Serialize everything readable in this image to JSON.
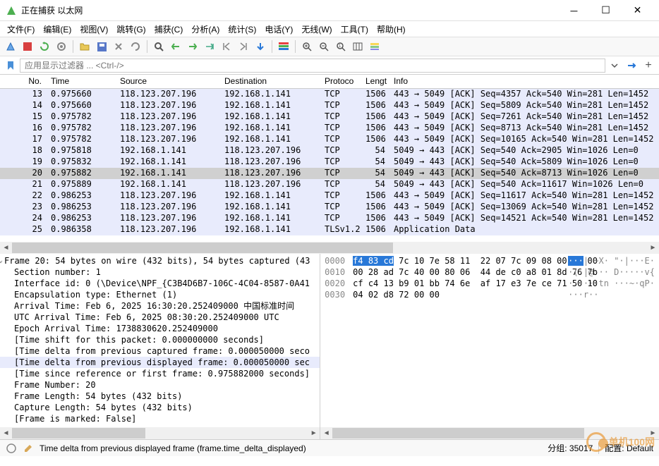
{
  "window": {
    "title": "正在捕获 以太网"
  },
  "menu": [
    {
      "label": "文件(F)"
    },
    {
      "label": "编辑(E)"
    },
    {
      "label": "视图(V)"
    },
    {
      "label": "跳转(G)"
    },
    {
      "label": "捕获(C)"
    },
    {
      "label": "分析(A)"
    },
    {
      "label": "统计(S)"
    },
    {
      "label": "电话(Y)"
    },
    {
      "label": "无线(W)"
    },
    {
      "label": "工具(T)"
    },
    {
      "label": "帮助(H)"
    }
  ],
  "filter": {
    "placeholder": "应用显示过滤器 ... <Ctrl-/>"
  },
  "columns": {
    "no": "No.",
    "time": "Time",
    "src": "Source",
    "dst": "Destination",
    "proto": "Protoco",
    "len": "Lengt",
    "info": "Info"
  },
  "packets": [
    {
      "no": 13,
      "time": "0.975660",
      "src": "118.123.207.196",
      "dst": "192.168.1.141",
      "proto": "TCP",
      "len": 1506,
      "info": "443 → 5049 [ACK] Seq=4357 Ack=540 Win=281 Len=1452",
      "cls": "blue"
    },
    {
      "no": 14,
      "time": "0.975660",
      "src": "118.123.207.196",
      "dst": "192.168.1.141",
      "proto": "TCP",
      "len": 1506,
      "info": "443 → 5049 [ACK] Seq=5809 Ack=540 Win=281 Len=1452",
      "cls": "blue"
    },
    {
      "no": 15,
      "time": "0.975782",
      "src": "118.123.207.196",
      "dst": "192.168.1.141",
      "proto": "TCP",
      "len": 1506,
      "info": "443 → 5049 [ACK] Seq=7261 Ack=540 Win=281 Len=1452",
      "cls": "blue"
    },
    {
      "no": 16,
      "time": "0.975782",
      "src": "118.123.207.196",
      "dst": "192.168.1.141",
      "proto": "TCP",
      "len": 1506,
      "info": "443 → 5049 [ACK] Seq=8713 Ack=540 Win=281 Len=1452",
      "cls": "blue"
    },
    {
      "no": 17,
      "time": "0.975782",
      "src": "118.123.207.196",
      "dst": "192.168.1.141",
      "proto": "TCP",
      "len": 1506,
      "info": "443 → 5049 [ACK] Seq=10165 Ack=540 Win=281 Len=1452",
      "cls": "blue"
    },
    {
      "no": 18,
      "time": "0.975818",
      "src": "192.168.1.141",
      "dst": "118.123.207.196",
      "proto": "TCP",
      "len": 54,
      "info": "5049 → 443 [ACK] Seq=540 Ack=2905 Win=1026 Len=0",
      "cls": "blue"
    },
    {
      "no": 19,
      "time": "0.975832",
      "src": "192.168.1.141",
      "dst": "118.123.207.196",
      "proto": "TCP",
      "len": 54,
      "info": "5049 → 443 [ACK] Seq=540 Ack=5809 Win=1026 Len=0",
      "cls": "blue"
    },
    {
      "no": 20,
      "time": "0.975882",
      "src": "192.168.1.141",
      "dst": "118.123.207.196",
      "proto": "TCP",
      "len": 54,
      "info": "5049 → 443 [ACK] Seq=540 Ack=8713 Win=1026 Len=0",
      "cls": "sel"
    },
    {
      "no": 21,
      "time": "0.975889",
      "src": "192.168.1.141",
      "dst": "118.123.207.196",
      "proto": "TCP",
      "len": 54,
      "info": "5049 → 443 [ACK] Seq=540 Ack=11617 Win=1026 Len=0",
      "cls": "blue"
    },
    {
      "no": 22,
      "time": "0.986253",
      "src": "118.123.207.196",
      "dst": "192.168.1.141",
      "proto": "TCP",
      "len": 1506,
      "info": "443 → 5049 [ACK] Seq=11617 Ack=540 Win=281 Len=1452",
      "cls": "blue"
    },
    {
      "no": 23,
      "time": "0.986253",
      "src": "118.123.207.196",
      "dst": "192.168.1.141",
      "proto": "TCP",
      "len": 1506,
      "info": "443 → 5049 [ACK] Seq=13069 Ack=540 Win=281 Len=1452",
      "cls": "blue"
    },
    {
      "no": 24,
      "time": "0.986253",
      "src": "118.123.207.196",
      "dst": "192.168.1.141",
      "proto": "TCP",
      "len": 1506,
      "info": "443 → 5049 [ACK] Seq=14521 Ack=540 Win=281 Len=1452",
      "cls": "blue"
    },
    {
      "no": 25,
      "time": "0.986358",
      "src": "118.123.207.196",
      "dst": "192.168.1.141",
      "proto": "TLSv1.2",
      "len": 1506,
      "info": "Application Data",
      "cls": "blue"
    }
  ],
  "detail": [
    {
      "text": "Frame 20: 54 bytes on wire (432 bits), 54 bytes captured (43",
      "root": true
    },
    {
      "text": "Section number: 1"
    },
    {
      "text": "Interface id: 0 (\\Device\\NPF_{C3B4D6B7-106C-4C04-8587-0A41"
    },
    {
      "text": "Encapsulation type: Ethernet (1)"
    },
    {
      "text": "Arrival Time: Feb  6, 2025 16:30:20.252409000 中国标准时间"
    },
    {
      "text": "UTC Arrival Time: Feb  6, 2025 08:30:20.252409000 UTC"
    },
    {
      "text": "Epoch Arrival Time: 1738830620.252409000"
    },
    {
      "text": "[Time shift for this packet: 0.000000000 seconds]"
    },
    {
      "text": "[Time delta from previous captured frame: 0.000050000 seco"
    },
    {
      "text": "[Time delta from previous displayed frame: 0.000050000 sec",
      "sel": true
    },
    {
      "text": "[Time since reference or first frame: 0.975882000 seconds]"
    },
    {
      "text": "Frame Number: 20"
    },
    {
      "text": "Frame Length: 54 bytes (432 bits)"
    },
    {
      "text": "Capture Length: 54 bytes (432 bits)"
    },
    {
      "text": "[Frame is marked: False]"
    }
  ],
  "hex": {
    "lines": [
      {
        "off": "0000",
        "bytes_sel": "f4 83 cd",
        "bytes": " 7c 10 7e 58 11  22 07 7c 09 08 00 45 00",
        "ascii_sel": "···",
        "ascii": "|·~X· \"·|···E·"
      },
      {
        "off": "0010",
        "bytes": "00 28 ad 7c 40 00 80 06  44 de c0 a8 01 8d 76 7b",
        "ascii": "·(·|@··· D·····v{"
      },
      {
        "off": "0020",
        "bytes": "cf c4 13 b9 01 bb 74 6e  af 17 e3 7e ce 71 50 10",
        "ascii": "······tn ···~·qP·"
      },
      {
        "off": "0030",
        "bytes": "04 02 d8 72 00 00",
        "ascii": "···r··"
      }
    ]
  },
  "status": {
    "left": "Time delta from previous displayed frame (frame.time_delta_displayed)",
    "right_packets": "分组: 35017",
    "right_profile": "配置: Default"
  },
  "watermark": "单机100网"
}
